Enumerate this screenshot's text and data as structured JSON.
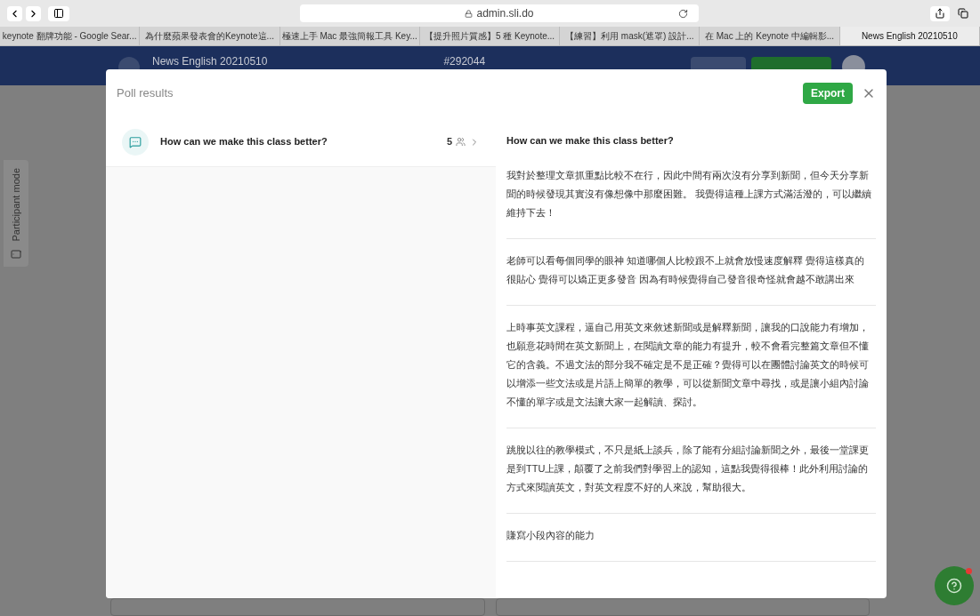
{
  "browser": {
    "address": "admin.sli.do",
    "tabs": [
      {
        "label": "keynote 翻牌功能 - Google Sear...",
        "selected": false
      },
      {
        "label": "為什麼蘋果發表會的Keynote這...",
        "selected": false
      },
      {
        "label": "極速上手 Mac 最強簡報工具 Key...",
        "selected": false
      },
      {
        "label": "【提升照片質感】5 種 Keynote...",
        "selected": false
      },
      {
        "label": "【練習】利用 mask(遮罩) 設計...",
        "selected": false
      },
      {
        "label": "在 Mac 上的 Keynote 中編輯影...",
        "selected": false
      },
      {
        "label": "News English 20210510",
        "selected": true
      }
    ]
  },
  "event": {
    "title": "News English 20210510",
    "code": "#292044"
  },
  "participant_mode": {
    "label": "Participant mode"
  },
  "dialog": {
    "title": "Poll results",
    "export": "Export",
    "polls": [
      {
        "question": "How can we make this class better?",
        "count": "5",
        "selected": true
      }
    ],
    "detail": {
      "question": "How can we make this class better?",
      "answers": [
        "我對於整理文章抓重點比較不在行，因此中間有兩次沒有分享到新聞，但今天分享新聞的時候發現其實沒有像想像中那麼困難。 我覺得這種上課方式滿活潑的，可以繼續維持下去！",
        "老師可以看每個同學的眼神 知道哪個人比較跟不上就會放慢速度解釋 覺得這樣真的很貼心 覺得可以矯正更多發音 因為有時候覺得自己發音很奇怪就會越不敢講出來",
        "上時事英文課程，逼自己用英文來敘述新聞或是解釋新聞，讓我的口說能力有增加，也願意花時間在英文新聞上，在閱讀文章的能力有提升，較不會看完整篇文章但不懂它的含義。不過文法的部分我不確定是不是正確？覺得可以在團體討論英文的時候可以增添一些文法或是片語上簡單的教學，可以從新聞文章中尋找，或是讓小組內討論不懂的單字或是文法讓大家一起解讀、探討。",
        "跳脫以往的教學模式，不只是紙上談兵，除了能有分組討論新聞之外，最後一堂課更是到TTU上課，顛覆了之前我們對學習上的認知，這點我覺得很棒！此外利用討論的方式來閱讀英文，對英文程度不好的人來說，幫助很大。",
        "賺寫小段內容的能力"
      ]
    }
  }
}
